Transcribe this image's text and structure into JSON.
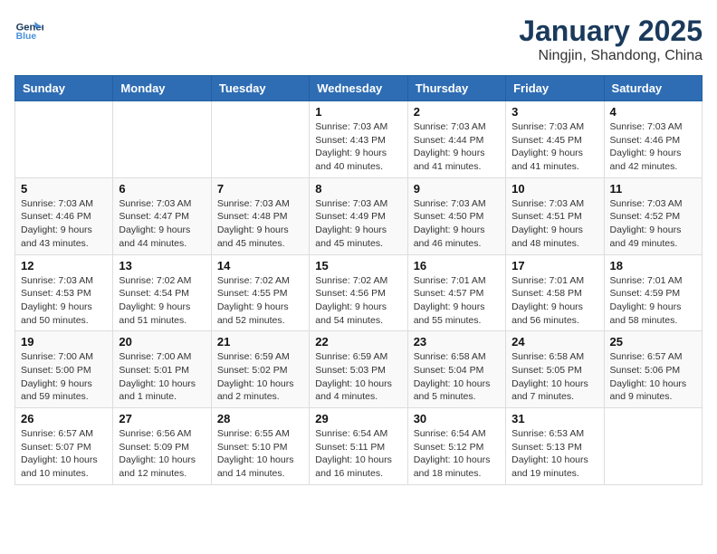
{
  "header": {
    "logo_line1": "General",
    "logo_line2": "Blue",
    "month": "January 2025",
    "location": "Ningjin, Shandong, China"
  },
  "weekdays": [
    "Sunday",
    "Monday",
    "Tuesday",
    "Wednesday",
    "Thursday",
    "Friday",
    "Saturday"
  ],
  "weeks": [
    [
      {
        "day": "",
        "info": ""
      },
      {
        "day": "",
        "info": ""
      },
      {
        "day": "",
        "info": ""
      },
      {
        "day": "1",
        "info": "Sunrise: 7:03 AM\nSunset: 4:43 PM\nDaylight: 9 hours\nand 40 minutes."
      },
      {
        "day": "2",
        "info": "Sunrise: 7:03 AM\nSunset: 4:44 PM\nDaylight: 9 hours\nand 41 minutes."
      },
      {
        "day": "3",
        "info": "Sunrise: 7:03 AM\nSunset: 4:45 PM\nDaylight: 9 hours\nand 41 minutes."
      },
      {
        "day": "4",
        "info": "Sunrise: 7:03 AM\nSunset: 4:46 PM\nDaylight: 9 hours\nand 42 minutes."
      }
    ],
    [
      {
        "day": "5",
        "info": "Sunrise: 7:03 AM\nSunset: 4:46 PM\nDaylight: 9 hours\nand 43 minutes."
      },
      {
        "day": "6",
        "info": "Sunrise: 7:03 AM\nSunset: 4:47 PM\nDaylight: 9 hours\nand 44 minutes."
      },
      {
        "day": "7",
        "info": "Sunrise: 7:03 AM\nSunset: 4:48 PM\nDaylight: 9 hours\nand 45 minutes."
      },
      {
        "day": "8",
        "info": "Sunrise: 7:03 AM\nSunset: 4:49 PM\nDaylight: 9 hours\nand 45 minutes."
      },
      {
        "day": "9",
        "info": "Sunrise: 7:03 AM\nSunset: 4:50 PM\nDaylight: 9 hours\nand 46 minutes."
      },
      {
        "day": "10",
        "info": "Sunrise: 7:03 AM\nSunset: 4:51 PM\nDaylight: 9 hours\nand 48 minutes."
      },
      {
        "day": "11",
        "info": "Sunrise: 7:03 AM\nSunset: 4:52 PM\nDaylight: 9 hours\nand 49 minutes."
      }
    ],
    [
      {
        "day": "12",
        "info": "Sunrise: 7:03 AM\nSunset: 4:53 PM\nDaylight: 9 hours\nand 50 minutes."
      },
      {
        "day": "13",
        "info": "Sunrise: 7:02 AM\nSunset: 4:54 PM\nDaylight: 9 hours\nand 51 minutes."
      },
      {
        "day": "14",
        "info": "Sunrise: 7:02 AM\nSunset: 4:55 PM\nDaylight: 9 hours\nand 52 minutes."
      },
      {
        "day": "15",
        "info": "Sunrise: 7:02 AM\nSunset: 4:56 PM\nDaylight: 9 hours\nand 54 minutes."
      },
      {
        "day": "16",
        "info": "Sunrise: 7:01 AM\nSunset: 4:57 PM\nDaylight: 9 hours\nand 55 minutes."
      },
      {
        "day": "17",
        "info": "Sunrise: 7:01 AM\nSunset: 4:58 PM\nDaylight: 9 hours\nand 56 minutes."
      },
      {
        "day": "18",
        "info": "Sunrise: 7:01 AM\nSunset: 4:59 PM\nDaylight: 9 hours\nand 58 minutes."
      }
    ],
    [
      {
        "day": "19",
        "info": "Sunrise: 7:00 AM\nSunset: 5:00 PM\nDaylight: 9 hours\nand 59 minutes."
      },
      {
        "day": "20",
        "info": "Sunrise: 7:00 AM\nSunset: 5:01 PM\nDaylight: 10 hours\nand 1 minute."
      },
      {
        "day": "21",
        "info": "Sunrise: 6:59 AM\nSunset: 5:02 PM\nDaylight: 10 hours\nand 2 minutes."
      },
      {
        "day": "22",
        "info": "Sunrise: 6:59 AM\nSunset: 5:03 PM\nDaylight: 10 hours\nand 4 minutes."
      },
      {
        "day": "23",
        "info": "Sunrise: 6:58 AM\nSunset: 5:04 PM\nDaylight: 10 hours\nand 5 minutes."
      },
      {
        "day": "24",
        "info": "Sunrise: 6:58 AM\nSunset: 5:05 PM\nDaylight: 10 hours\nand 7 minutes."
      },
      {
        "day": "25",
        "info": "Sunrise: 6:57 AM\nSunset: 5:06 PM\nDaylight: 10 hours\nand 9 minutes."
      }
    ],
    [
      {
        "day": "26",
        "info": "Sunrise: 6:57 AM\nSunset: 5:07 PM\nDaylight: 10 hours\nand 10 minutes."
      },
      {
        "day": "27",
        "info": "Sunrise: 6:56 AM\nSunset: 5:09 PM\nDaylight: 10 hours\nand 12 minutes."
      },
      {
        "day": "28",
        "info": "Sunrise: 6:55 AM\nSunset: 5:10 PM\nDaylight: 10 hours\nand 14 minutes."
      },
      {
        "day": "29",
        "info": "Sunrise: 6:54 AM\nSunset: 5:11 PM\nDaylight: 10 hours\nand 16 minutes."
      },
      {
        "day": "30",
        "info": "Sunrise: 6:54 AM\nSunset: 5:12 PM\nDaylight: 10 hours\nand 18 minutes."
      },
      {
        "day": "31",
        "info": "Sunrise: 6:53 AM\nSunset: 5:13 PM\nDaylight: 10 hours\nand 19 minutes."
      },
      {
        "day": "",
        "info": ""
      }
    ]
  ]
}
